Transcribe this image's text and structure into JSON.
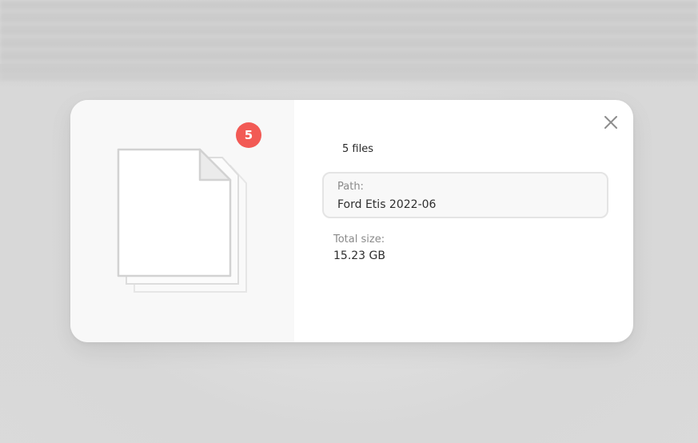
{
  "dialog": {
    "badge_count": "5",
    "files_count_label": "5 files",
    "path": {
      "label": "Path:",
      "value": "Ford Etis 2022-06"
    },
    "total_size": {
      "label": "Total size:",
      "value": "15.23 GB"
    },
    "icons": {
      "close": "close-icon",
      "preview": "file-stack-icon"
    }
  },
  "colors": {
    "badge": "#f25a55",
    "dialog_bg": "#ffffff",
    "preview_bg": "#f8f8f8",
    "backdrop": "#dcdcdc"
  }
}
